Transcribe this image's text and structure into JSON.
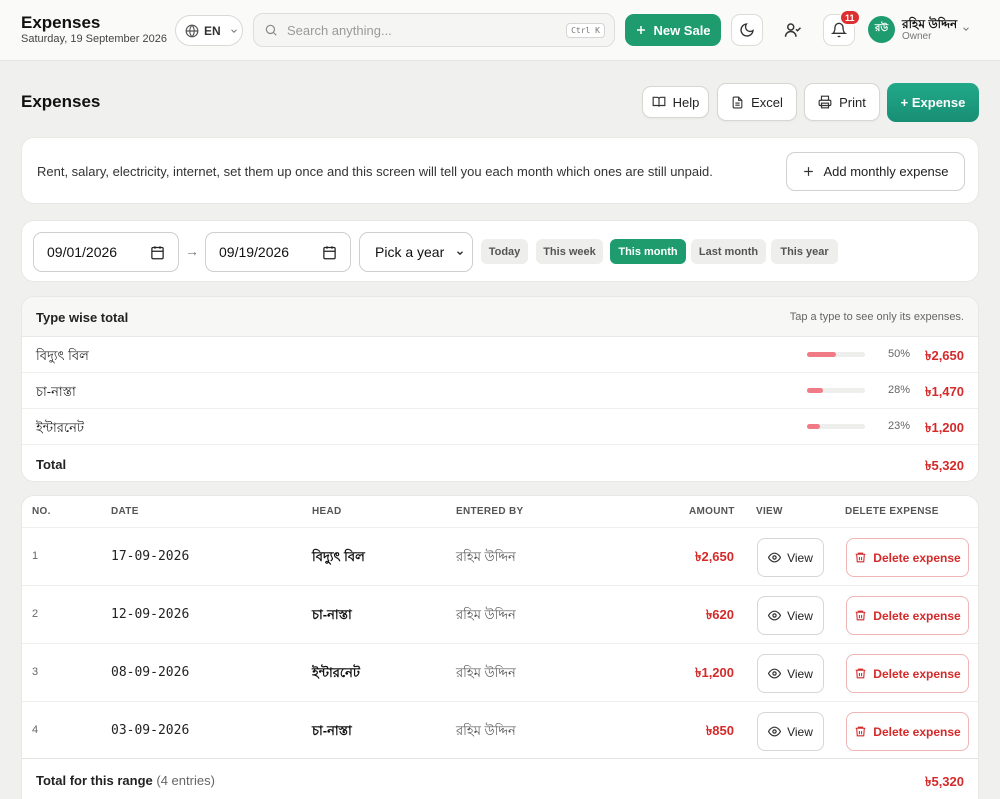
{
  "topbar": {
    "title": "Expenses",
    "date": "Saturday, 19 September 2026",
    "language": "EN",
    "search_placeholder": "Search anything...",
    "search_shortcut": "Ctrl K",
    "new_sale_label": "New Sale",
    "notification_count": "11",
    "user": {
      "initials": "রউ",
      "name": "রহিম উদ্দিন",
      "role": "Owner"
    }
  },
  "header": {
    "title": "Expenses",
    "help_label": "Help",
    "excel_label": "Excel",
    "print_label": "Print",
    "add_expense_label": "+ Expense"
  },
  "info": {
    "text": "Rent, salary, electricity, internet, set them up once and this screen will tell you each month which ones are still unpaid.",
    "add_monthly_label": "Add monthly expense"
  },
  "filters": {
    "from_date": "09/01/2026",
    "to_date": "09/19/2026",
    "arrow": "→",
    "year_placeholder": "Pick a year",
    "chips": [
      "Today",
      "This week",
      "This month",
      "Last month",
      "This year"
    ],
    "active_chip": "This month"
  },
  "type_totals": {
    "title": "Type wise total",
    "hint": "Tap a type to see only its expenses.",
    "rows": [
      {
        "name": "বিদ্যুৎ বিল",
        "percent": "50%",
        "share": 0.5,
        "amount": "৳2,650"
      },
      {
        "name": "চা-নাস্তা",
        "percent": "28%",
        "share": 0.28,
        "amount": "৳1,470"
      },
      {
        "name": "ইন্টারনেট",
        "percent": "23%",
        "share": 0.23,
        "amount": "৳1,200"
      }
    ],
    "total_label": "Total",
    "total_amount": "৳5,320"
  },
  "table": {
    "columns": [
      "NO.",
      "DATE",
      "HEAD",
      "ENTERED BY",
      "AMOUNT",
      "VIEW",
      "DELETE EXPENSE"
    ],
    "rows": [
      {
        "no": "1",
        "date": "17-09-2026",
        "head": "বিদ্যুৎ বিল",
        "entered_by": "রহিম উদ্দিন",
        "amount": "৳2,650"
      },
      {
        "no": "2",
        "date": "12-09-2026",
        "head": "চা-নাস্তা",
        "entered_by": "রহিম উদ্দিন",
        "amount": "৳620"
      },
      {
        "no": "3",
        "date": "08-09-2026",
        "head": "ইন্টারনেট",
        "entered_by": "রহিম উদ্দিন",
        "amount": "৳1,200"
      },
      {
        "no": "4",
        "date": "03-09-2026",
        "head": "চা-নাস্তা",
        "entered_by": "রহিম উদ্দিন",
        "amount": "৳850"
      }
    ],
    "view_label": "View",
    "delete_label": "Delete expense",
    "footer_label": "Total for this range",
    "footer_count": "(4 entries)",
    "footer_amount": "৳5,320"
  },
  "colors": {
    "accent": "#1e9c6e",
    "danger": "#d42a2a",
    "bar": "#f07a85"
  }
}
